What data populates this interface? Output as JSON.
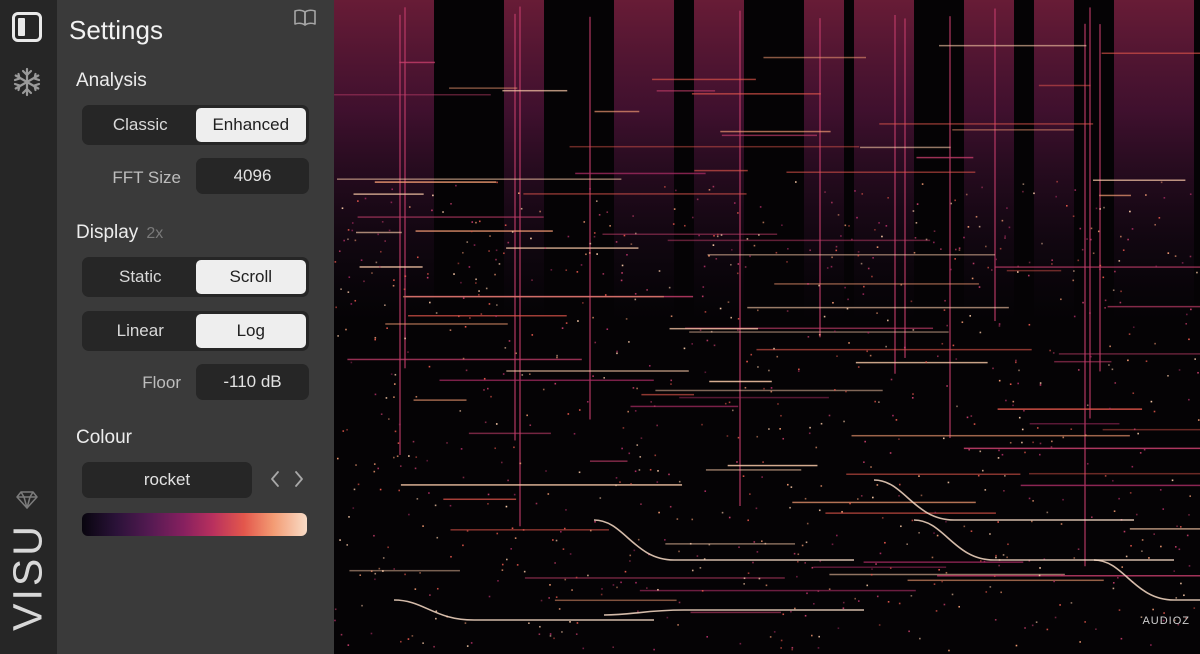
{
  "app": {
    "name": "VISU"
  },
  "settings": {
    "title": "Settings",
    "analysis": {
      "heading": "Analysis",
      "mode_options": [
        "Classic",
        "Enhanced"
      ],
      "mode_selected": "Enhanced",
      "fft_label": "FFT Size",
      "fft_value": "4096"
    },
    "display": {
      "heading": "Display",
      "zoom": "2x",
      "motion_options": [
        "Static",
        "Scroll"
      ],
      "motion_selected": "Scroll",
      "scale_options": [
        "Linear",
        "Log"
      ],
      "scale_selected": "Log",
      "floor_label": "Floor",
      "floor_value": "-110 dB"
    },
    "colour": {
      "heading": "Colour",
      "colormap": "rocket"
    }
  },
  "icons": {
    "rail": [
      "panel-toggle-icon",
      "snowflake-icon",
      "gem-icon"
    ],
    "panel": [
      "book-icon",
      "chevron-left-icon",
      "chevron-right-icon"
    ]
  },
  "watermark": "AUDIOZ",
  "colors": {
    "rail_bg": "#262626",
    "panel_bg": "#3a3a3a",
    "control_bg": "#262626",
    "active_bg": "#eeeeee"
  }
}
